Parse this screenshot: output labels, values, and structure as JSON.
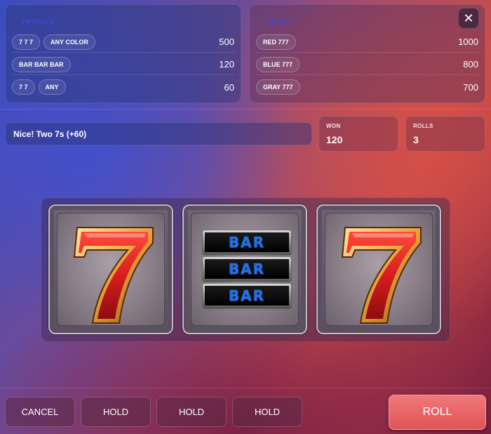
{
  "payouts": {
    "title": "PAYOUTS",
    "rows": [
      {
        "chips": [
          "7 7 7",
          "ANY COLOR"
        ],
        "value": "500"
      },
      {
        "chips": [
          "BAR BAR BAR"
        ],
        "value": "120"
      },
      {
        "chips": [
          "7 7",
          "ANY"
        ],
        "value": "60"
      }
    ]
  },
  "bonus": {
    "title": "BONUS",
    "rows": [
      {
        "chips": [
          "RED 777"
        ],
        "value": "1000"
      },
      {
        "chips": [
          "BLUE 777"
        ],
        "value": "800"
      },
      {
        "chips": [
          "GRAY 777"
        ],
        "value": "700"
      }
    ]
  },
  "close": {
    "icon": "close-icon",
    "glyph": "✕"
  },
  "message": "Nice! Two 7s (+60)",
  "stats": {
    "won": {
      "label": "WON",
      "value": "120"
    },
    "rolls": {
      "label": "ROLLS",
      "value": "3"
    }
  },
  "reels": [
    {
      "symbol": "seven"
    },
    {
      "symbol": "bar-bar-bar",
      "bars": [
        "BAR",
        "BAR",
        "BAR"
      ]
    },
    {
      "symbol": "seven"
    }
  ],
  "buttons": {
    "cancel": "CANCEL",
    "hold1": "HOLD",
    "hold2": "HOLD",
    "hold3": "HOLD",
    "roll": "ROLL"
  },
  "colors": {
    "title_accent": "#3a4ad8",
    "roll_button": "#e96366",
    "bar_text": "#1e6fe8",
    "seven_red": "#d81d1d",
    "seven_gold": "#e8a23a"
  }
}
